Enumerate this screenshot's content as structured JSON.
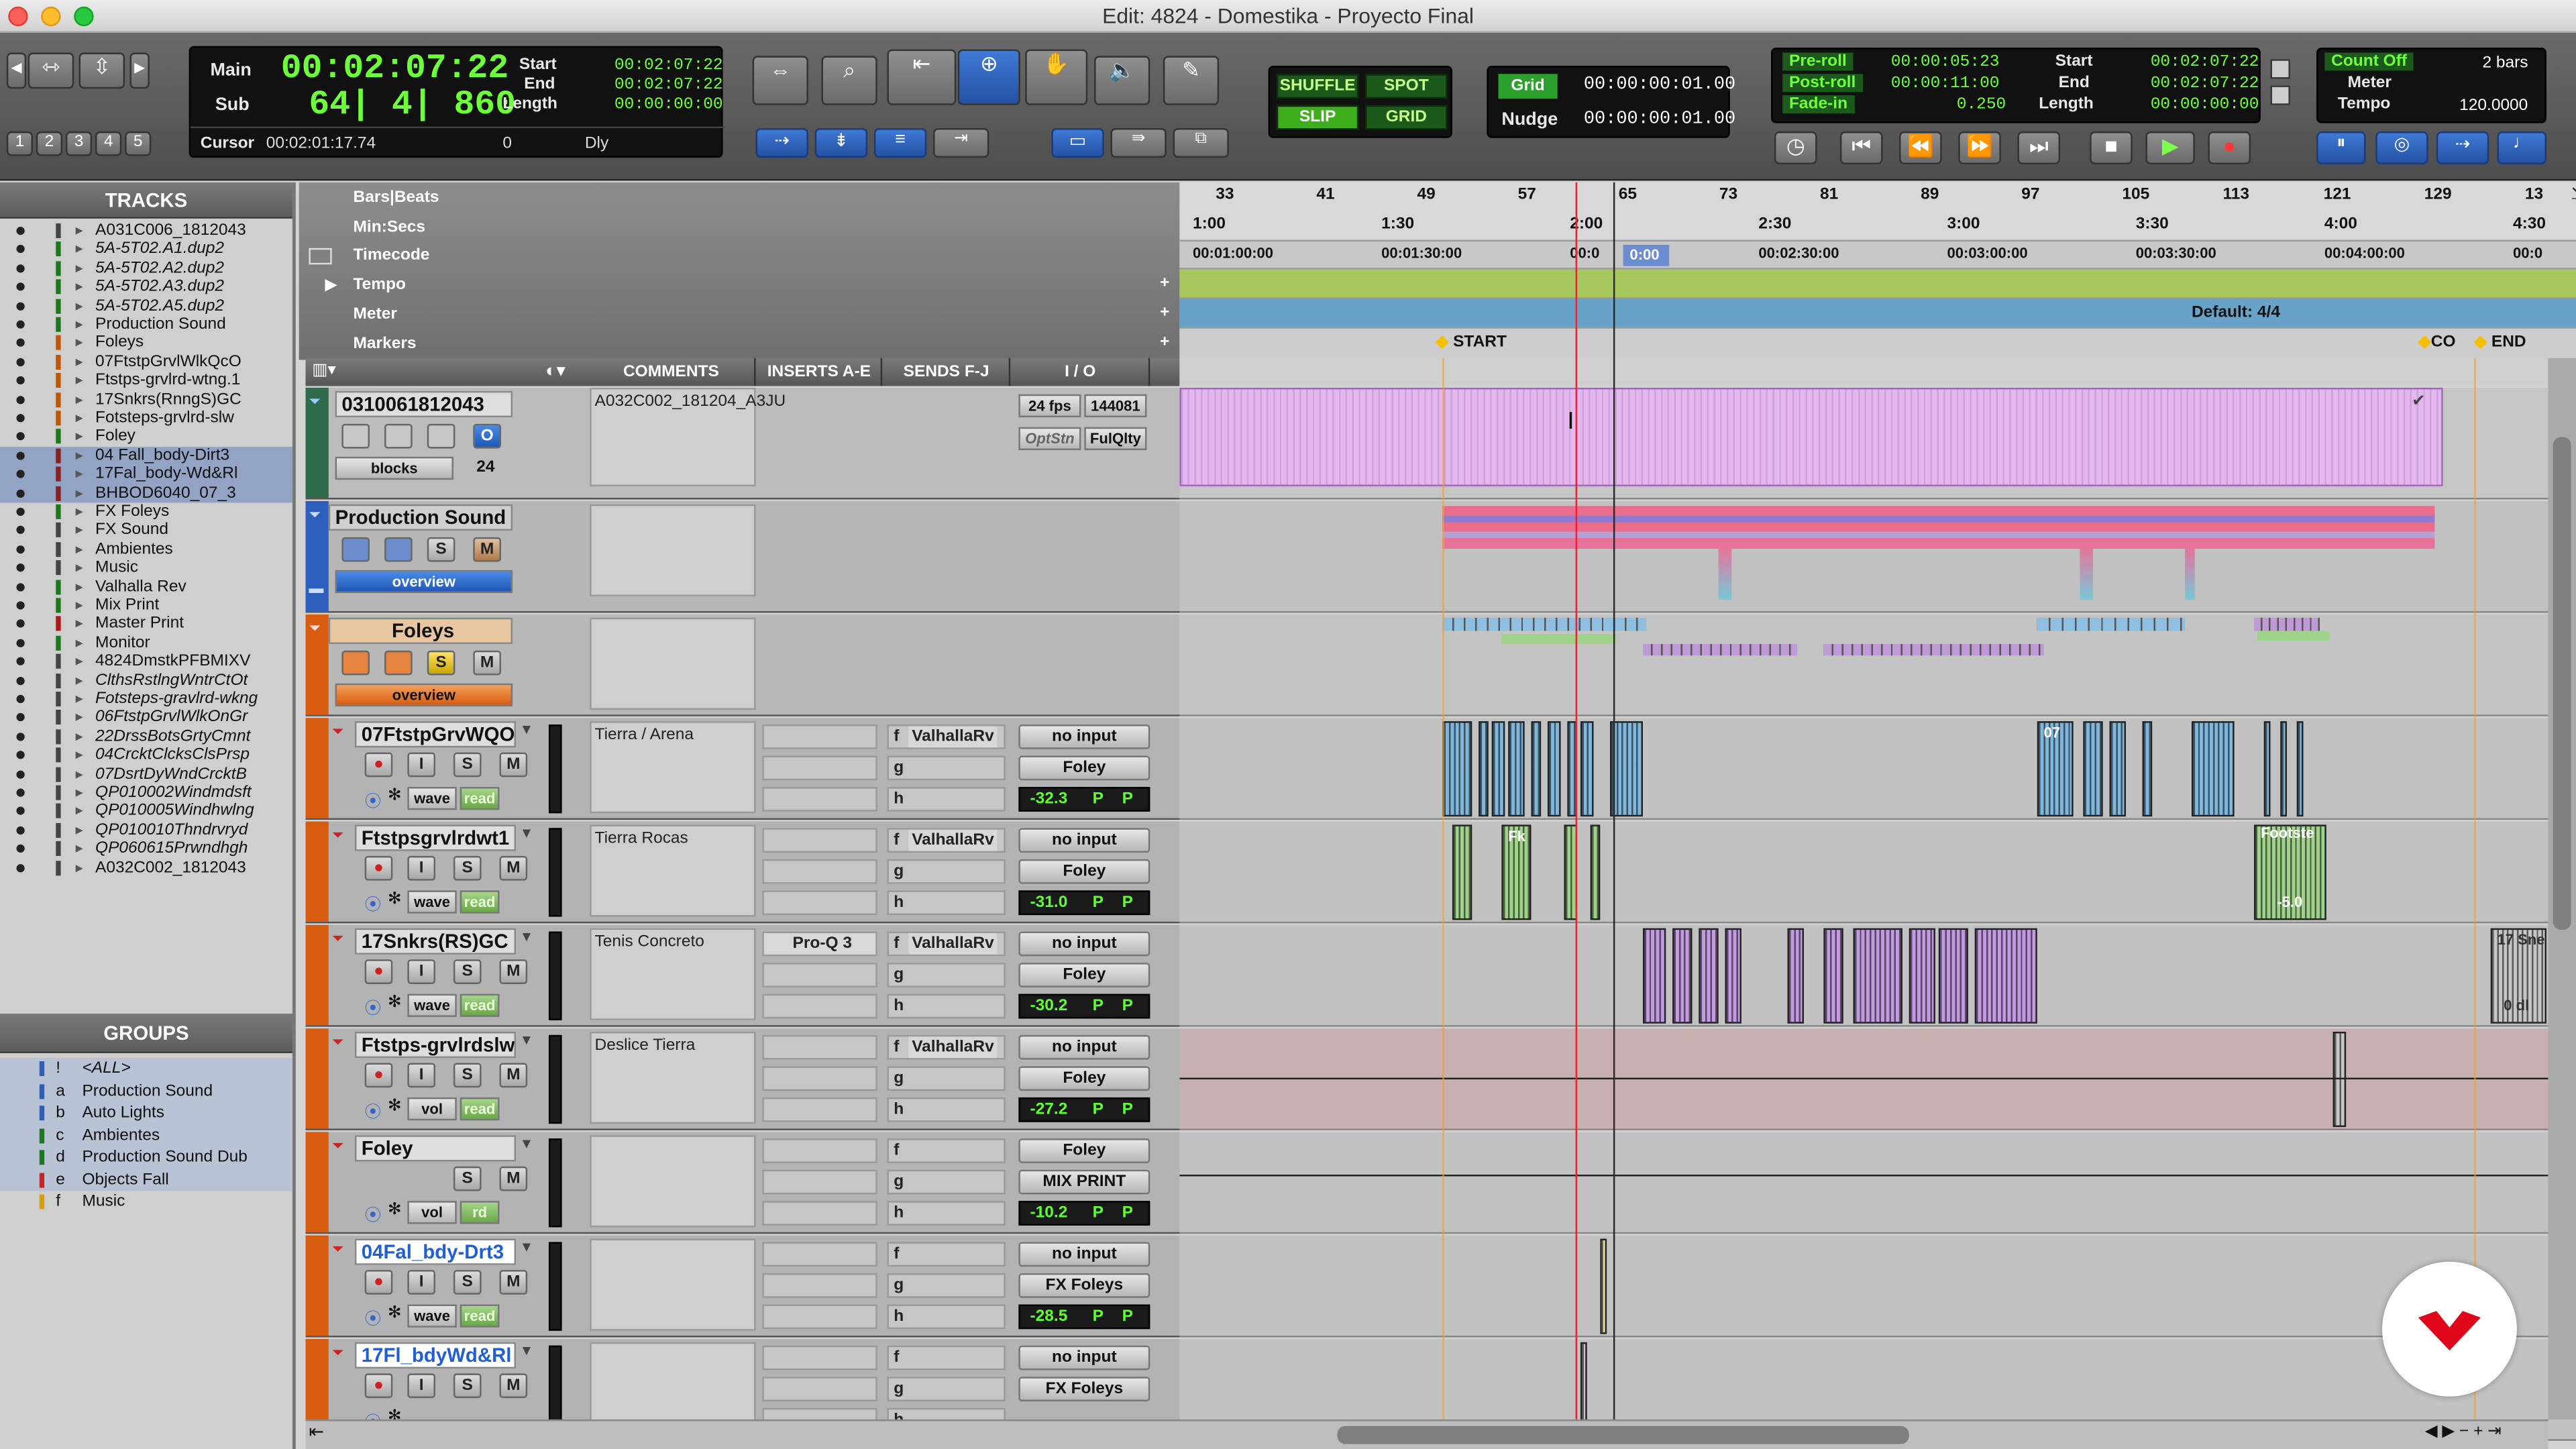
{
  "window": {
    "title": "Edit: 4824 - Domestika - Proyecto Final"
  },
  "counters": {
    "main_label": "Main",
    "main_value": "00:02:07:22",
    "sub_label": "Sub",
    "sub_value": "64| 4| 860",
    "start_label": "Start",
    "end_label": "End",
    "length_label": "Length",
    "start": "00:02:07:22",
    "end": "00:02:07:22",
    "length": "00:00:00:00",
    "cursor_label": "Cursor",
    "cursor_value": "00:02:01:17.74",
    "cursor_extra": "0",
    "dly": "Dly"
  },
  "numbers": [
    "1",
    "2",
    "3",
    "4",
    "5"
  ],
  "edit_modes": {
    "shuffle": "SHUFFLE",
    "spot": "SPOT",
    "slip": "SLIP",
    "grid": "GRID"
  },
  "grid": {
    "grid_label": "Grid",
    "grid_value": "00:00:00:01.00",
    "nudge_label": "Nudge",
    "nudge_value": "00:00:00:01.00"
  },
  "transport_counters": {
    "preroll_label": "Pre-roll",
    "preroll": "00:00:05:23",
    "postroll_label": "Post-roll",
    "postroll": "00:00:11:00",
    "fadein_label": "Fade-in",
    "fadein": "0.250",
    "start_label": "Start",
    "start": "00:02:07:22",
    "end_label": "End",
    "end": "00:02:07:22",
    "length_label": "Length",
    "length": "00:00:00:00"
  },
  "meter_panel": {
    "count_off": "Count Off",
    "meter": "Meter",
    "tempo": "Tempo",
    "bars": "2 bars",
    "tempo_value": "120.0000"
  },
  "tracks_panel": {
    "title": "TRACKS",
    "items": [
      {
        "name": "A031C006_1812043",
        "italic": false,
        "color": "#444"
      },
      {
        "name": "5A-5T02.A1.dup2",
        "italic": true,
        "color": "#1a7a1a"
      },
      {
        "name": "5A-5T02.A2.dup2",
        "italic": true,
        "color": "#1a7a1a"
      },
      {
        "name": "5A-5T02.A3.dup2",
        "italic": true,
        "color": "#1a7a1a"
      },
      {
        "name": "5A-5T02.A5.dup2",
        "italic": true,
        "color": "#1a7a1a"
      },
      {
        "name": "Production Sound",
        "italic": false,
        "color": "#1a7a1a"
      },
      {
        "name": "Foleys",
        "italic": false,
        "color": "#c25500"
      },
      {
        "name": "07FtstpGrvlWlkQcO",
        "italic": false,
        "color": "#c25500"
      },
      {
        "name": "Ftstps-grvlrd-wtng.1",
        "italic": false,
        "color": "#c25500"
      },
      {
        "name": "17Snkrs(RnngS)GC",
        "italic": false,
        "color": "#c25500"
      },
      {
        "name": "Fotsteps-grvlrd-slw",
        "italic": false,
        "color": "#c25500"
      },
      {
        "name": "Foley",
        "italic": false,
        "color": "#1a7a1a"
      },
      {
        "name": "04 Fall_body-Dirt3",
        "italic": false,
        "color": "#8a2020"
      },
      {
        "name": "17Fal_body-Wd&Rl",
        "italic": false,
        "color": "#8a2020"
      },
      {
        "name": "BHBOD6040_07_3",
        "italic": false,
        "color": "#8a2020"
      },
      {
        "name": "FX Foleys",
        "italic": false,
        "color": "#1a7a1a"
      },
      {
        "name": "FX Sound",
        "italic": false,
        "color": "#444"
      },
      {
        "name": "Ambientes",
        "italic": false,
        "color": "#444"
      },
      {
        "name": "Music",
        "italic": false,
        "color": "#444"
      },
      {
        "name": "Valhalla Rev",
        "italic": false,
        "color": "#1a7a1a"
      },
      {
        "name": "Mix Print",
        "italic": false,
        "color": "#1a7a1a"
      },
      {
        "name": "Master Print",
        "italic": false,
        "color": "#b01818"
      },
      {
        "name": "Monitor",
        "italic": false,
        "color": "#1a7a1a"
      },
      {
        "name": "4824DmstkPFBMIXV",
        "italic": false,
        "color": "#444"
      },
      {
        "name": "ClthsRstlngWntrCtOt",
        "italic": true,
        "color": "#444"
      },
      {
        "name": "Fotsteps-gravlrd-wkng",
        "italic": true,
        "color": "#444"
      },
      {
        "name": "06FtstpGrvlWlkOnGr",
        "italic": true,
        "color": "#444"
      },
      {
        "name": "22DrssBotsGrtyCmnt",
        "italic": true,
        "color": "#444"
      },
      {
        "name": "04CrcktClcksClsPrsp",
        "italic": true,
        "color": "#444"
      },
      {
        "name": "07DsrtDyWndCrcktB",
        "italic": true,
        "color": "#444"
      },
      {
        "name": "QP010002Windmdsft",
        "italic": true,
        "color": "#444"
      },
      {
        "name": "QP010005Windhwlng",
        "italic": true,
        "color": "#444"
      },
      {
        "name": "QP010010Thndrvryd",
        "italic": true,
        "color": "#444"
      },
      {
        "name": "QP060615Prwndhgh",
        "italic": true,
        "color": "#444"
      },
      {
        "name": "A032C002_1812043",
        "italic": false,
        "color": "#444"
      }
    ]
  },
  "groups_panel": {
    "title": "GROUPS",
    "items": [
      {
        "id": "!",
        "name": "<ALL>",
        "italic": true
      },
      {
        "id": "a",
        "name": "Production Sound",
        "italic": false
      },
      {
        "id": "b",
        "name": "Auto Lights",
        "italic": false
      },
      {
        "id": "c",
        "name": "Ambientes",
        "italic": false
      },
      {
        "id": "d",
        "name": "Production Sound Dub",
        "italic": false
      },
      {
        "id": "e",
        "name": "Objects Fall",
        "italic": false
      },
      {
        "id": "f",
        "name": "Music",
        "italic": false
      }
    ]
  },
  "rulers": {
    "bars": "Bars|Beats",
    "minsecs": "Min:Secs",
    "timecode": "Timecode",
    "tempo": "Tempo",
    "meter": "Meter",
    "markers": "Markers",
    "bar_ticks": [
      "33",
      "41",
      "49",
      "57",
      "65",
      "73",
      "81",
      "89",
      "97",
      "105",
      "113",
      "121",
      "129",
      "13"
    ],
    "min_ticks": [
      "1:00",
      "1:30",
      "2:00",
      "2:30",
      "3:00",
      "3:30",
      "4:00",
      "4:30"
    ],
    "tc_ticks": [
      "00:01:00:00",
      "00:01:30:00",
      "00:0",
      "00:02:30:00",
      "00:03:00:00",
      "00:03:30:00",
      "00:04:00:00",
      "00:0"
    ],
    "tc_split": "0:00",
    "meter_default": "Default: 4/4",
    "marker_start": "START",
    "marker_co": "CO",
    "marker_end": "END"
  },
  "columns": {
    "comments": "COMMENTS",
    "inserts": "INSERTS A-E",
    "sends": "SENDS F-J",
    "io": "I / O"
  },
  "video_track": {
    "name": "0310061812043",
    "comment": "A032C002_181204_A3JU",
    "blocks": "blocks",
    "value24": "24",
    "fps": "24 fps",
    "frames": "144081",
    "optstn": "OptStn",
    "fulqlty": "FulQlty",
    "o": "O"
  },
  "production_track": {
    "name": "Production Sound",
    "view": "overview"
  },
  "foleys_track": {
    "name": "Foleys",
    "view": "overview"
  },
  "audio_tracks": [
    {
      "name": "07FtstpGrvWQO",
      "comment": "Tierra / Arena",
      "insert": "",
      "send": "ValhallaRv",
      "input": "no input",
      "output": "Foley",
      "vol": "-32.3",
      "view": "wave",
      "auto": "read"
    },
    {
      "name": "Ftstpsgrvlrdwt1",
      "comment": "Tierra Rocas",
      "insert": "",
      "send": "ValhallaRv",
      "input": "no input",
      "output": "Foley",
      "vol": "-31.0",
      "view": "wave",
      "auto": "read"
    },
    {
      "name": "17Snkrs(RS)GC",
      "comment": "Tenis Concreto",
      "insert": "Pro-Q 3",
      "send": "ValhallaRv",
      "input": "no input",
      "output": "Foley",
      "vol": "-30.2",
      "view": "wave",
      "auto": "read"
    },
    {
      "name": "Ftstps-grvlrdslw",
      "comment": "Deslice Tierra",
      "insert": "",
      "send": "ValhallaRv",
      "input": "no input",
      "output": "Foley",
      "vol": "-27.2",
      "view": "vol",
      "auto": "read"
    },
    {
      "name": "Foley",
      "comment": "",
      "insert": "",
      "send": "",
      "input": "Foley",
      "output": "MIX PRINT",
      "vol": "-10.2",
      "view": "vol",
      "auto": "rd"
    },
    {
      "name": "04Fal_bdy-Drt3",
      "comment": "",
      "insert": "",
      "send": "",
      "input": "no input",
      "output": "FX Foleys",
      "vol": "-28.5",
      "view": "wave",
      "auto": "read"
    },
    {
      "name": "17Fl_bdyWd&Rl",
      "comment": "",
      "insert": "",
      "send": "",
      "input": "no input",
      "output": "FX Foleys",
      "vol": "",
      "view": "",
      "auto": ""
    }
  ],
  "clips": {
    "footsteps_label": "Footste",
    "footsteps_gain": "-5.0",
    "snkrs_label": "17 Sne",
    "snkrs_gain": "0 dl",
    "label07": "07",
    "fk": "Fk"
  },
  "button_labels": {
    "s": "S",
    "m": "M",
    "i": "I",
    "p": "P"
  },
  "slot_letters": [
    "f",
    "g",
    "h"
  ],
  "colors": {
    "accent_blue": "#2c5fbd",
    "foley_orange": "#d85d10",
    "green_lcd": "#6dff3a",
    "purple_clip": "#e1b3ef"
  }
}
